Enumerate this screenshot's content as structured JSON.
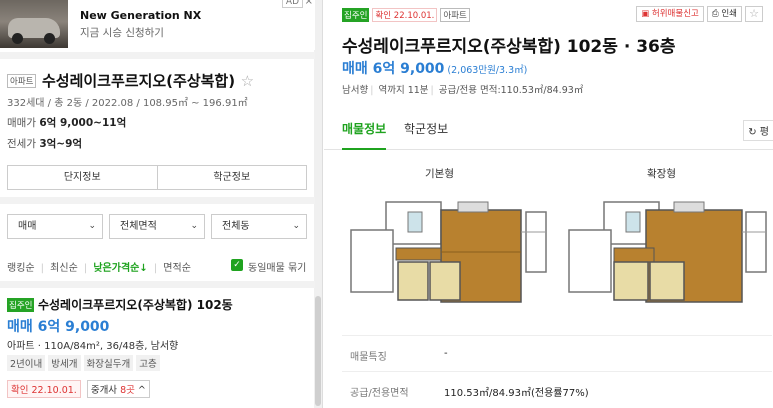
{
  "ad": {
    "title": "New Generation NX",
    "subtitle": "지금 시승 신청하기",
    "badge": "AD",
    "close": "×"
  },
  "complex": {
    "type_tag": "아파트",
    "name": "수성레이크푸르지오(주상복합)",
    "star": "☆",
    "meta": "332세대 / 총 2동 / 2022.08 / 108.95㎡ ~ 196.91㎡",
    "sale_label": "매매가",
    "sale_value": "6억 9,000~11억",
    "jeonse_label": "전세가",
    "jeonse_value": "3억~9억",
    "buttons": [
      "단지정보",
      "학군정보"
    ]
  },
  "filters": [
    {
      "label": "매매"
    },
    {
      "label": "전체면적"
    },
    {
      "label": "전체동"
    }
  ],
  "sorts": {
    "ranking": "랭킹순",
    "latest": "최신순",
    "low_price": "낮은가격순↓",
    "area": "면적순",
    "group_label": "동일매물 묶기",
    "check": "✓"
  },
  "listing": {
    "tag": "집주인",
    "name": "수성레이크푸르지오(주상복합) 102동",
    "price": "매매 6억 9,000",
    "spec": "아파트 · 110A/84m², 36/48층, 남서향",
    "chips": [
      "2년이내",
      "방세개",
      "화장실두개",
      "고층"
    ],
    "confirm": "확인 22.10.01.",
    "agent_prefix": "중개사",
    "agent_count": "8곳",
    "agent_chev": "^"
  },
  "detail": {
    "tags": {
      "owner": "집주인",
      "confirm": "확인 22.10.01.",
      "type": "아파트"
    },
    "actions": {
      "report": "허위매물신고",
      "print": "인쇄",
      "star": "☆"
    },
    "title": "수성레이크푸르지오(주상복합) 102동 · 36층",
    "price": "매매 6억 9,000",
    "price_per": "(2,063만원/3.3㎡)",
    "meta_direction": "남서향",
    "meta_station": "역까지 11분",
    "meta_area": "공급/전용 면적:110.53㎡/84.93㎡",
    "tabs": [
      "매물정보",
      "학군정보"
    ],
    "tab_more": "평",
    "plan_basic": "기본형",
    "plan_extended": "확장형",
    "info": [
      {
        "k": "매물특징",
        "v": "-"
      },
      {
        "k": "공급/전용면적",
        "v": "110.53㎡/84.93㎡(전용률77%)"
      }
    ]
  },
  "colors": {
    "accent_green": "#1fa31f",
    "price_blue": "#2a7ed3",
    "confirm_red": "#d33333"
  }
}
